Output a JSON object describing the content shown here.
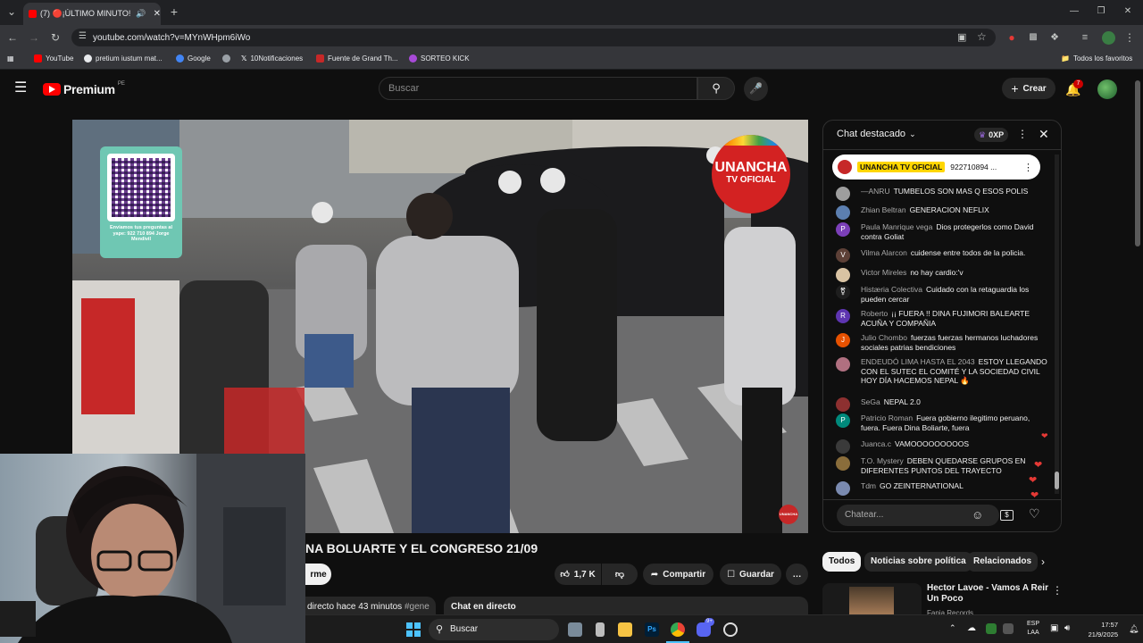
{
  "browser": {
    "tab_title": "(7) 🔴¡ÚLTIMO MINUTO! M",
    "new_tab": "+",
    "url": "youtube.com/watch?v=MYnWHpm6iWo",
    "bookmarks": [
      {
        "label": "YouTube",
        "color": "#ff0000"
      },
      {
        "label": "pretium iustum mat...",
        "color": "#e8eaed"
      },
      {
        "label": "Google",
        "color": "#4285f4"
      },
      {
        "label": "",
        "color": "#9aa0a6"
      },
      {
        "label": "10Notificaciones",
        "color": "#000000"
      },
      {
        "label": "Fuente de Grand Th...",
        "color": "#c62828"
      },
      {
        "label": "SORTEO KICK",
        "color": "#a84ad8"
      }
    ],
    "all_bookmarks": "Todos los favoritos"
  },
  "youtube": {
    "logo": "Premium",
    "region": "PE",
    "search_placeholder": "Buscar",
    "create_label": "Crear",
    "notif_count": "7"
  },
  "video": {
    "qr_caption": "Enviamos tus preguntas al yape: 922 710 894 Jorge Mendivil",
    "channel_logo_line1": "UNANCHA",
    "channel_logo_line2": "TV OFICIAL",
    "corner_logo": "UNANCHA"
  },
  "below_video": {
    "title": "NA BOLUARTE Y EL CONGRESO 21/09",
    "subscribe_fragment": "rme",
    "likes": "1,7 K",
    "share": "Compartir",
    "save": "Guardar",
    "more": "…",
    "desc_meta": "directo hace 43 minutos",
    "desc_tag": "#gene",
    "chat_live": "Chat en directo"
  },
  "chat": {
    "header": "Chat destacado",
    "points": "0XP",
    "pinned_author": "UNANCHA TV OFICIAL",
    "pinned_text": "922710894 ...",
    "input_placeholder": "Chatear...",
    "messages": [
      {
        "author": "—ANRU",
        "text": "TUMBELOS SON MAS Q ESOS POLIS",
        "avatar": "",
        "color": "#9e9e9e"
      },
      {
        "author": "Zhian Beltran",
        "text": "GENERACION NEFLIX",
        "avatar": "",
        "color": "#5c7fb0"
      },
      {
        "author": "Paula Manrique vega",
        "text": "Dios protegerlos como David contra Goliat",
        "avatar": "P",
        "color": "#7b3fb8"
      },
      {
        "author": "Vilma Alarcon",
        "text": "cuidense entre todos de la policia.",
        "avatar": "V",
        "color": "#5d4037"
      },
      {
        "author": "Victor Mireles",
        "text": "no hay cardio:'v",
        "avatar": "",
        "color": "#d9c3a3"
      },
      {
        "author": "Histæria Colectiva",
        "text": "Cuidado con la retaguardia los pueden cercar",
        "avatar": "⚧",
        "color": "#1e1e1e"
      },
      {
        "author": "Roberto",
        "text": "¡¡ FUERA !! DINA FUJIMORI BALEARTE ACUÑA Y COMPAÑIA",
        "avatar": "R",
        "color": "#5e35b1"
      },
      {
        "author": "Julio Chombo",
        "text": "fuerzas fuerzas hermanos luchadores sociales patrias bendiciones",
        "avatar": "J",
        "color": "#e65100"
      },
      {
        "author": "ENDEUDÓ LIMA HASTA EL 2043",
        "text": "ESTOY LLEGANDO CON EL SUTEC EL COMITÉ Y LA SOCIEDAD CIVIL HOY DÍA HACEMOS NEPAL 🔥",
        "avatar": "",
        "color": "#b07080"
      },
      {
        "author": "SeGa",
        "text": "NEPAL 2.0",
        "avatar": "",
        "color": "#8d3030"
      },
      {
        "author": "Patricio Roman",
        "text": "Fuera gobierno ilegitimo peruano, fuera. Fuera Dina Boliarte, fuera",
        "avatar": "P",
        "color": "#00897b"
      },
      {
        "author": "Juanca.c",
        "text": "VAMOOOOOOOOOS",
        "avatar": "",
        "color": "#3a3a3a"
      },
      {
        "author": "T.O. Mystery",
        "text": "DEBEN QUEDARSE GRUPOS EN DIFERENTES PUNTOS DEL TRAYECTO",
        "avatar": "",
        "color": "#8a6d3b"
      },
      {
        "author": "Tdm",
        "text": "GO ZEINTERNATIONAL",
        "avatar": "",
        "color": "#7a8ab0"
      }
    ]
  },
  "suggestions": {
    "chips": [
      "Todos",
      "Noticias sobre política",
      "Relacionados"
    ],
    "video_title": "Hector Lavoe - Vamos A Reir Un Poco",
    "video_channel": "Fania Records"
  },
  "taskbar": {
    "search": "Buscar",
    "lang_top": "ESP",
    "lang_bottom": "LAA",
    "time": "17:57",
    "date": "21/9/2025",
    "discord_badge": "9+"
  },
  "colors": {
    "accent_red": "#ff0000",
    "chat_bg": "#0f0f0f",
    "pill_bg": "#272727"
  }
}
